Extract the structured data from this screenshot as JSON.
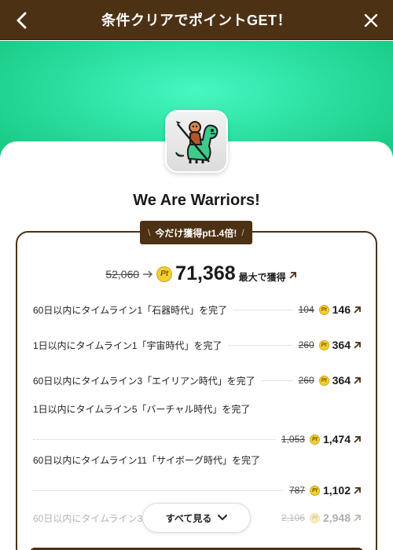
{
  "header": {
    "title": "条件クリアでポイントGET！",
    "back_icon": "chevron-left-icon",
    "close_icon": "close-icon"
  },
  "app": {
    "title": "We Are Warriors!",
    "icon": "warrior-riding-dinosaur-icon"
  },
  "boost_badge": {
    "text": "今だけ獲得pt1.4倍!",
    "deco_left": "\\",
    "deco_right": "/"
  },
  "total": {
    "old": "52,060",
    "new": "71,368",
    "label": "最大で獲得"
  },
  "tasks": [
    {
      "text": "60日以内にタイムライン1「石器時代」を完了",
      "old": "104",
      "new": "146"
    },
    {
      "text": "1日以内にタイムライン1「宇宙時代」を完了",
      "old": "260",
      "new": "364"
    },
    {
      "text": "60日以内にタイムライン3「エイリアン時代」を完了",
      "old": "260",
      "new": "364"
    },
    {
      "text": "1日以内にタイムライン5「バーチャル時代」を完了",
      "old": "1,053",
      "new": "1,474"
    },
    {
      "text": "60日以内にタイムライン11「サイボーグ時代」を完了",
      "old": "787",
      "new": "1,102"
    },
    {
      "text": "60日以内にタイムライン3",
      "old": "2,106",
      "new": "2,948"
    }
  ],
  "see_all": {
    "label": "すべて見る"
  },
  "pt_icon_label": "Pt",
  "colors": {
    "header_bg": "#4c3115",
    "hero_green": "#2fe3a6",
    "pt_gold": "#f1cf34",
    "accent_brown": "#4c3115"
  }
}
